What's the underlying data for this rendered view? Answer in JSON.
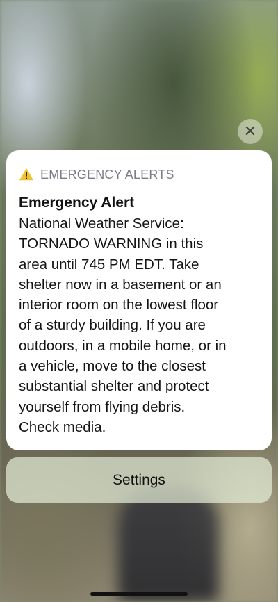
{
  "screen": {
    "close_icon": "close-icon",
    "close_symbol": "✕",
    "colors": {
      "card_background": "#ffffff",
      "button_background": "#e2ebd6",
      "warning_yellow": "#f2c230",
      "header_gray": "#7a7d86",
      "text_dark": "#121212"
    }
  },
  "alert": {
    "icon": "warning-icon",
    "header": "EMERGENCY ALERTS",
    "title": "Emergency Alert",
    "body_lines": [
      "National Weather Service:",
      "TORNADO WARNING in this",
      "area until 745 PM EDT. Take",
      "shelter now in a basement or an",
      "interior room on the lowest floor",
      "of a sturdy building. If you are",
      "outdoors, in a mobile home, or in",
      "a vehicle, move to the closest",
      "substantial shelter and protect",
      "yourself from flying debris.",
      "Check media."
    ]
  },
  "actions": {
    "settings_label": "Settings"
  }
}
